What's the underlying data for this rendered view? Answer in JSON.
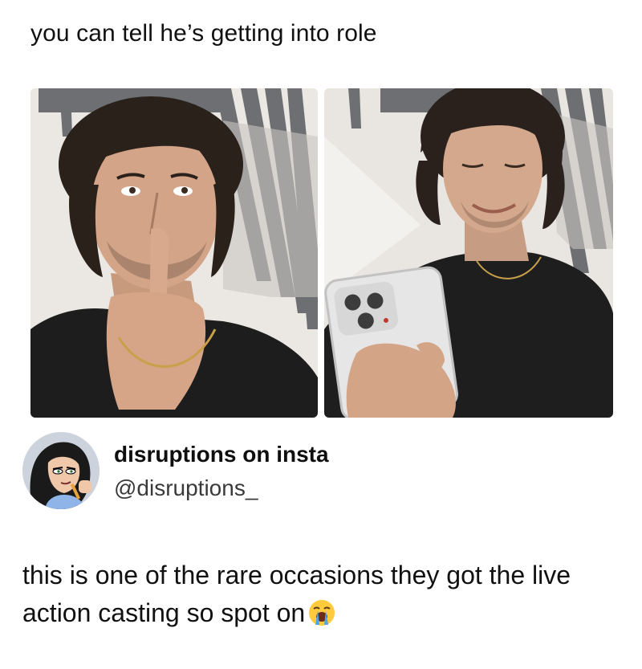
{
  "post": {
    "caption": "you can tell he’s getting into role"
  },
  "images": [
    {
      "icon": "photo-man-shushing"
    },
    {
      "icon": "photo-man-holding-phone"
    }
  ],
  "tweet": {
    "display_name": "disruptions on insta",
    "handle": "@disruptions_",
    "text": "this is one of the rare occasions they got the live action casting so spot on",
    "emoji": "loudly-crying-face-icon",
    "avatar_icon": "cartoon-avatar"
  },
  "colors": {
    "text": "#111111",
    "handle": "#3a3a3a",
    "background": "#ffffff"
  }
}
